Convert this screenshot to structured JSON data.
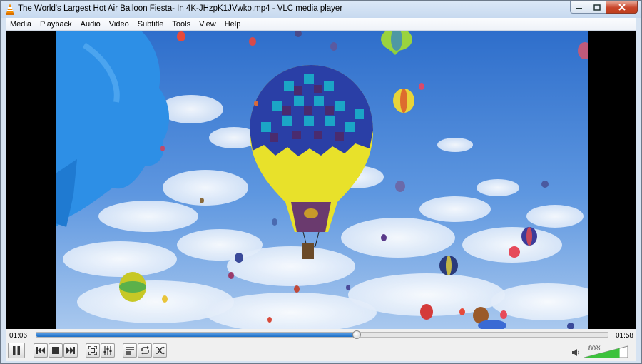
{
  "window": {
    "title": "The World's Largest Hot Air Balloon Fiesta- In 4K-JHzpK1JVwko.mp4 - VLC media player",
    "app_icon": "vlc-cone-icon",
    "controls": [
      "minimize-icon",
      "maximize-icon",
      "close-icon"
    ]
  },
  "menu": {
    "items": [
      {
        "label": "Media"
      },
      {
        "label": "Playback"
      },
      {
        "label": "Audio"
      },
      {
        "label": "Video"
      },
      {
        "label": "Subtitle"
      },
      {
        "label": "Tools"
      },
      {
        "label": "View"
      },
      {
        "label": "Help"
      }
    ]
  },
  "player": {
    "current_time": "01:06",
    "total_time": "01:58",
    "progress": 0.56,
    "volume_label": "80%",
    "volume_level": 0.8
  },
  "buttons": [
    {
      "name": "pause-button",
      "icon": "pause-icon"
    },
    {
      "name": "previous-button",
      "icon": "skip-previous-icon"
    },
    {
      "name": "stop-button",
      "icon": "stop-icon"
    },
    {
      "name": "next-button",
      "icon": "skip-next-icon"
    },
    {
      "name": "fullscreen-button",
      "icon": "fullscreen-icon"
    },
    {
      "name": "extended-settings-button",
      "icon": "equalizer-icon"
    },
    {
      "name": "playlist-button",
      "icon": "playlist-icon"
    },
    {
      "name": "loop-button",
      "icon": "loop-icon"
    },
    {
      "name": "shuffle-button",
      "icon": "shuffle-icon"
    }
  ],
  "colors": {
    "accent": "#1d6fc6",
    "volume_green": "#3cc23c",
    "sky": "#3f7fd6"
  }
}
